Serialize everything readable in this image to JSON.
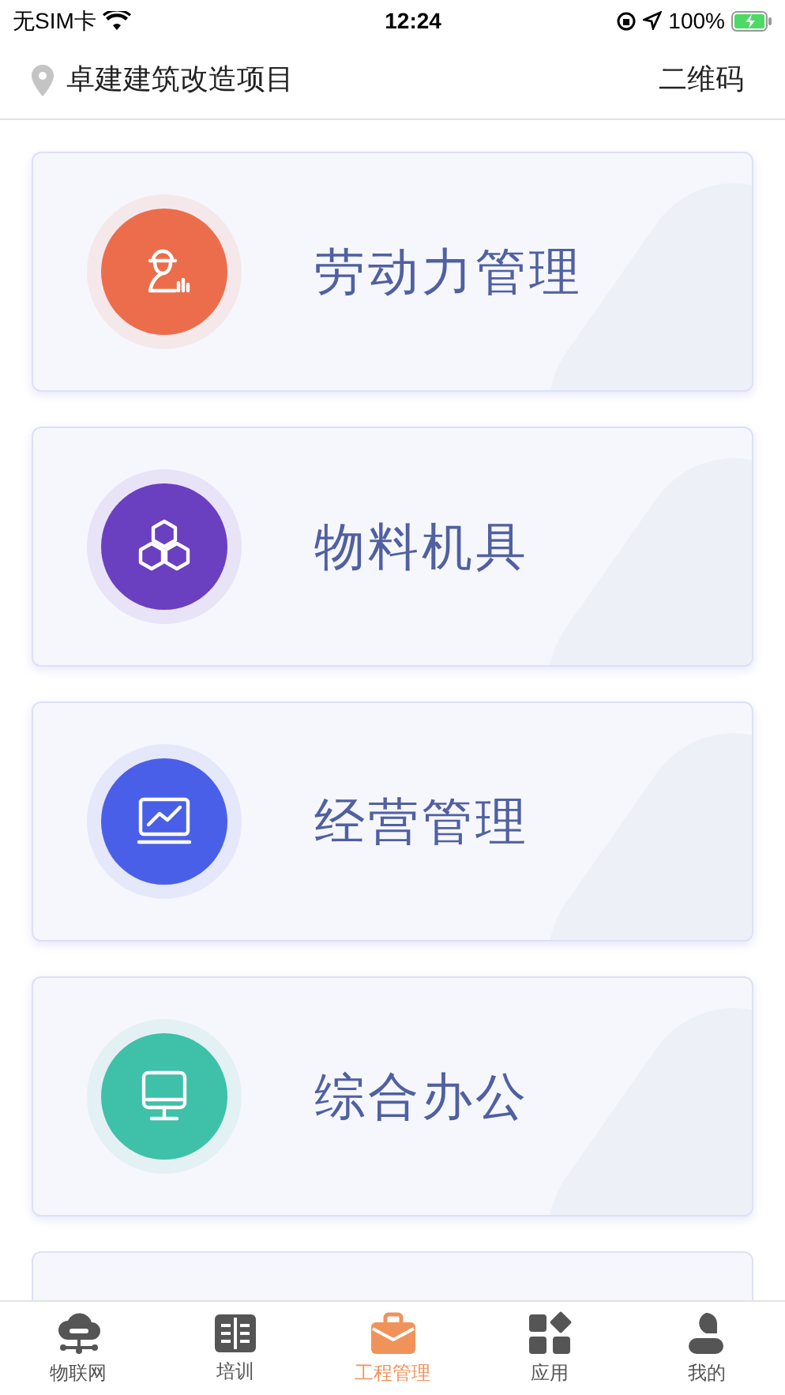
{
  "status_bar": {
    "carrier": "无SIM卡",
    "time": "12:24",
    "battery": "100%"
  },
  "header": {
    "project": "卓建建筑改造项目",
    "action": "二维码"
  },
  "modules": [
    {
      "label": "劳动力管理",
      "kind": "worker",
      "color": "#ec6d4c"
    },
    {
      "label": "物料机具",
      "kind": "cubes",
      "color": "#6a3fc0"
    },
    {
      "label": "经营管理",
      "kind": "chart",
      "color": "#4a5fe8"
    },
    {
      "label": "综合办公",
      "kind": "monitor",
      "color": "#3fc0a8"
    }
  ],
  "tabs": [
    {
      "label": "物联网",
      "kind": "cloud",
      "selected": false
    },
    {
      "label": "培训",
      "kind": "book",
      "selected": false
    },
    {
      "label": "工程管理",
      "kind": "briefcase",
      "selected": true
    },
    {
      "label": "应用",
      "kind": "apps",
      "selected": false
    },
    {
      "label": "我的",
      "kind": "user",
      "selected": false
    }
  ]
}
